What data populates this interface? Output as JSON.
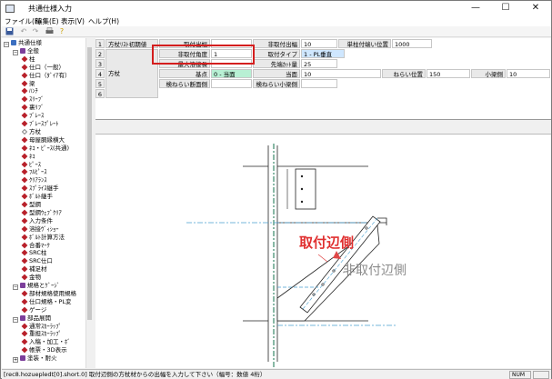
{
  "window": {
    "title": "共通仕様入力",
    "minimize": "—",
    "maximize": "☐",
    "close": "✕"
  },
  "menu": [
    "ファイル(F)",
    "編集(E)",
    "表示(V)",
    "ヘルプ(H)"
  ],
  "toolbar": {
    "icons": [
      "save-icon",
      "undo-icon",
      "redo-icon",
      "print-icon",
      "help-icon"
    ]
  },
  "tree": [
    {
      "label": "共通仕様",
      "level": 0,
      "icon": "blue",
      "exp": "−"
    },
    {
      "label": "全般",
      "level": 1,
      "icon": "purple",
      "exp": "−"
    },
    {
      "label": "柱",
      "level": 2,
      "icon": "red"
    },
    {
      "label": "仕口（一般）",
      "level": 2,
      "icon": "red"
    },
    {
      "label": "仕口（ﾀﾞｲｱ有）",
      "level": 2,
      "icon": "red"
    },
    {
      "label": "梁",
      "level": 2,
      "icon": "red"
    },
    {
      "label": "ﾊﾝﾁ",
      "level": 2,
      "icon": "red"
    },
    {
      "label": "ｽﾘｰﾌﾞ",
      "level": 2,
      "icon": "red"
    },
    {
      "label": "裏ﾘﾌﾞ",
      "level": 2,
      "icon": "red"
    },
    {
      "label": "ﾌﾞﾚｰｽ",
      "level": 2,
      "icon": "red"
    },
    {
      "label": "ﾌﾞﾚｰｽﾌﾟﾚｰﾄ",
      "level": 2,
      "icon": "red"
    },
    {
      "label": "方杖",
      "level": 2,
      "icon": "outline"
    },
    {
      "label": "母屋胴縁横大",
      "level": 2,
      "icon": "red"
    },
    {
      "label": "ﾈｺ・ﾋﾟｰｽ(共通)",
      "level": 2,
      "icon": "red"
    },
    {
      "label": "ﾈｺ",
      "level": 2,
      "icon": "red"
    },
    {
      "label": "ﾋﾟｰｽ",
      "level": 2,
      "icon": "red"
    },
    {
      "label": "ﾌﾙﾋﾟｰｽ",
      "level": 2,
      "icon": "red"
    },
    {
      "label": "ｸﾘｱﾗﾝｽ",
      "level": 2,
      "icon": "red"
    },
    {
      "label": "ｽﾌﾟﾗｲｽ継手",
      "level": 2,
      "icon": "red"
    },
    {
      "label": "ﾎﾞﾙﾄ継手",
      "level": 2,
      "icon": "red"
    },
    {
      "label": "型鋼",
      "level": 2,
      "icon": "red"
    },
    {
      "label": "型鋼ｳｪﾌﾞｸﾘｱ",
      "level": 2,
      "icon": "red"
    },
    {
      "label": "入力条件",
      "level": 2,
      "icon": "red"
    },
    {
      "label": "溶接ｳﾞｨｼｮｰ",
      "level": 2,
      "icon": "red"
    },
    {
      "label": "ﾎﾞﾙﾄ計算方法",
      "level": 2,
      "icon": "red"
    },
    {
      "label": "合番ﾏｰｸ",
      "level": 2,
      "icon": "red"
    },
    {
      "label": "SRC柱",
      "level": 2,
      "icon": "red"
    },
    {
      "label": "SRC仕口",
      "level": 2,
      "icon": "red"
    },
    {
      "label": "補足材",
      "level": 2,
      "icon": "red"
    },
    {
      "label": "金物",
      "level": 2,
      "icon": "red"
    },
    {
      "label": "規格とｹﾞｰｼﾞ",
      "level": 1,
      "icon": "purple",
      "exp": "−"
    },
    {
      "label": "部材規格使用規格",
      "level": 2,
      "icon": "red"
    },
    {
      "label": "仕口規格・PL変",
      "level": 2,
      "icon": "red"
    },
    {
      "label": "ゲージ",
      "level": 2,
      "icon": "red"
    },
    {
      "label": "部品展開",
      "level": 1,
      "icon": "purple",
      "exp": "−"
    },
    {
      "label": "通常ｽｶｰﾗｯﾌﾟ",
      "level": 2,
      "icon": "red"
    },
    {
      "label": "重担ｽｶｰﾗｯﾌﾟ",
      "level": 2,
      "icon": "red"
    },
    {
      "label": "入稿・加工・ﾎﾞ",
      "level": 2,
      "icon": "red"
    },
    {
      "label": "帳票・3D表示",
      "level": 2,
      "icon": "red"
    },
    {
      "label": "塗装・耐火",
      "level": 1,
      "icon": "purple",
      "exp": "+"
    }
  ],
  "grid": {
    "row_numbers": [
      "1",
      "2",
      "3",
      "4",
      "5",
      "6"
    ],
    "section_labels": {
      "r1": "方杖ﾘｽﾄ初期値",
      "r2": "方杖"
    },
    "cells": {
      "r1_l1": "取付出幅",
      "r1_v1": "",
      "r1_l2": "非取付出幅",
      "r1_v2": "10",
      "r1_l3": "単柱付端い位置",
      "r1_v3": "1000",
      "r2_l1": "非取付角度",
      "r2_v1": "1",
      "r2_l2": "取付タイプ",
      "r2_v2": "1 - PL垂直",
      "r3_l1": "最大溶接長",
      "r3_l2": "先端ｶｯﾄ量",
      "r3_v2": "25",
      "r4_l1": "基点",
      "r4_v1": "0 - 当面",
      "r4_l2": "当面",
      "r4_v2": "10",
      "r4_l3": "ねらい位置",
      "r4_v3": "150",
      "r4_l4": "小梁側",
      "r4_v4": "10",
      "r5_l1": "検ねらい断面側",
      "r5_l2": "検ねらい小梁側"
    }
  },
  "drawing": {
    "label_attach": "取付辺側",
    "label_nonattach": "非取付辺側"
  },
  "status": {
    "message": "[rec8.hozuepledt[0].short.0] 取付辺側の方杖材からの出幅を入力して下さい（幅号：数値 4桁）",
    "num": "NUM"
  }
}
